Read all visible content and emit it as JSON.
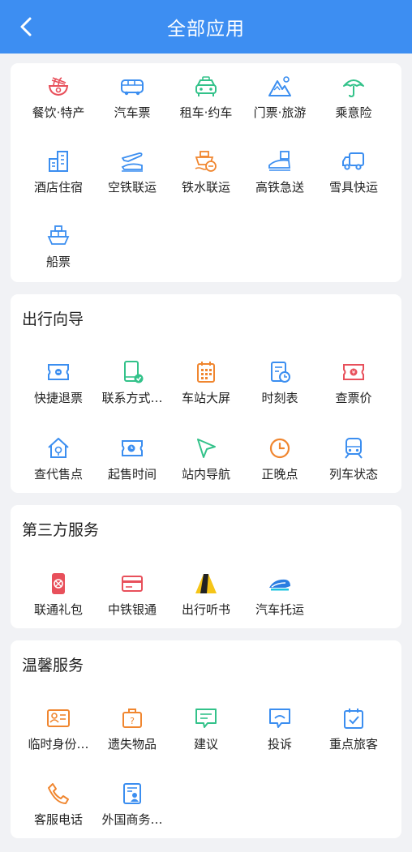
{
  "header": {
    "title": "全部应用"
  },
  "sections": {
    "travel": {
      "items": [
        {
          "label": "餐饮·特产",
          "icon": "noodle-bowl-icon"
        },
        {
          "label": "汽车票",
          "icon": "bus-icon"
        },
        {
          "label": "租车·约车",
          "icon": "car-icon"
        },
        {
          "label": "门票·旅游",
          "icon": "mountain-icon"
        },
        {
          "label": "乘意险",
          "icon": "umbrella-icon"
        },
        {
          "label": "酒店住宿",
          "icon": "hotel-building-icon"
        },
        {
          "label": "空铁联运",
          "icon": "plane-train-icon"
        },
        {
          "label": "铁水联运",
          "icon": "ship-train-icon"
        },
        {
          "label": "高铁急送",
          "icon": "bullet-train-package-icon"
        },
        {
          "label": "雪具快运",
          "icon": "delivery-truck-icon"
        },
        {
          "label": "船票",
          "icon": "ship-icon"
        }
      ]
    },
    "guide": {
      "title": "出行向导",
      "items": [
        {
          "label": "快捷退票",
          "icon": "ticket-refund-icon"
        },
        {
          "label": "联系方式…",
          "icon": "phone-check-icon"
        },
        {
          "label": "车站大屏",
          "icon": "station-screen-icon"
        },
        {
          "label": "时刻表",
          "icon": "timetable-icon"
        },
        {
          "label": "查票价",
          "icon": "ticket-price-icon"
        },
        {
          "label": "查代售点",
          "icon": "agency-house-icon"
        },
        {
          "label": "起售时间",
          "icon": "sale-time-icon"
        },
        {
          "label": "站内导航",
          "icon": "navigation-arrow-icon"
        },
        {
          "label": "正晚点",
          "icon": "clock-icon"
        },
        {
          "label": "列车状态",
          "icon": "train-status-icon"
        }
      ]
    },
    "third_party": {
      "title": "第三方服务",
      "items": [
        {
          "label": "联通礼包",
          "icon": "unicom-sim-icon"
        },
        {
          "label": "中铁银通",
          "icon": "bank-card-icon"
        },
        {
          "label": "出行听书",
          "icon": "audiobook-icon"
        },
        {
          "label": "汽车托运",
          "icon": "car-shipping-icon"
        }
      ]
    },
    "care": {
      "title": "温馨服务",
      "items": [
        {
          "label": "临时身份…",
          "icon": "id-card-icon"
        },
        {
          "label": "遗失物品",
          "icon": "lost-luggage-icon"
        },
        {
          "label": "建议",
          "icon": "suggestion-icon"
        },
        {
          "label": "投诉",
          "icon": "complaint-icon"
        },
        {
          "label": "重点旅客",
          "icon": "priority-passenger-icon"
        },
        {
          "label": "客服电话",
          "icon": "phone-icon"
        },
        {
          "label": "外国商务…",
          "icon": "foreign-business-icon"
        }
      ]
    }
  },
  "colors": {
    "header": "#3d8ef2",
    "red": "#e8505b",
    "blue": "#3b8ef0",
    "green": "#33c28a",
    "orange": "#f0862f",
    "yellow": "#f5c518"
  }
}
